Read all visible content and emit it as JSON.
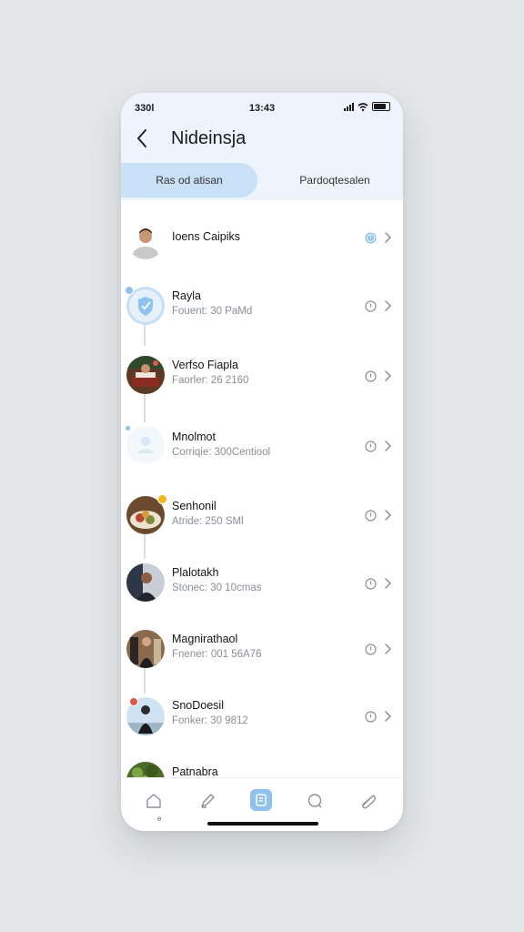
{
  "status_bar": {
    "left": "330l",
    "time": "13:43"
  },
  "header": {
    "title": "Nideinsja"
  },
  "tabs": [
    {
      "label": "Ras od atisan",
      "active": true
    },
    {
      "label": "Pardoqtesalen",
      "active": false
    }
  ],
  "colors": {
    "accent": "#8fc2ee",
    "tab_active_bg": "#c9e1f7",
    "header_bg": "#eef4fb",
    "badge_red": "#e4574f",
    "badge_yellow": "#f3b81c"
  },
  "list": [
    {
      "name": "Ioens Caipiks",
      "sub": "",
      "avatar": "person-portrait"
    },
    {
      "name": "Rayla",
      "sub": "Fouent: 30 PaMd",
      "avatar": "shield-icon"
    },
    {
      "name": "Verfso Fiapla",
      "sub": "Faorler: 26 2160",
      "avatar": "restaurant-photo"
    },
    {
      "name": "Mnolmot",
      "sub": "Corriqie: 300Centiool",
      "avatar": "user-placeholder"
    },
    {
      "name": "Senhonil",
      "sub": "Atride: 250 SMl",
      "avatar": "food-plate-photo"
    },
    {
      "name": "Plalotakh",
      "sub": "Stonec: 30 10cmas",
      "avatar": "person-photo"
    },
    {
      "name": "Magnirathaol",
      "sub": "Fnener: 001 56A76",
      "avatar": "group-photo"
    },
    {
      "name": "SnoDoesil",
      "sub": "Fonker: 30 9812",
      "avatar": "person-outdoor-photo"
    },
    {
      "name": "Patnabra",
      "sub": "",
      "avatar": "plant-photo"
    }
  ],
  "bottom_nav": [
    {
      "icon": "home-icon"
    },
    {
      "icon": "edit-icon"
    },
    {
      "icon": "contacts-icon",
      "active": true
    },
    {
      "icon": "chat-icon"
    },
    {
      "icon": "attachment-icon"
    }
  ],
  "home_dot": "e"
}
